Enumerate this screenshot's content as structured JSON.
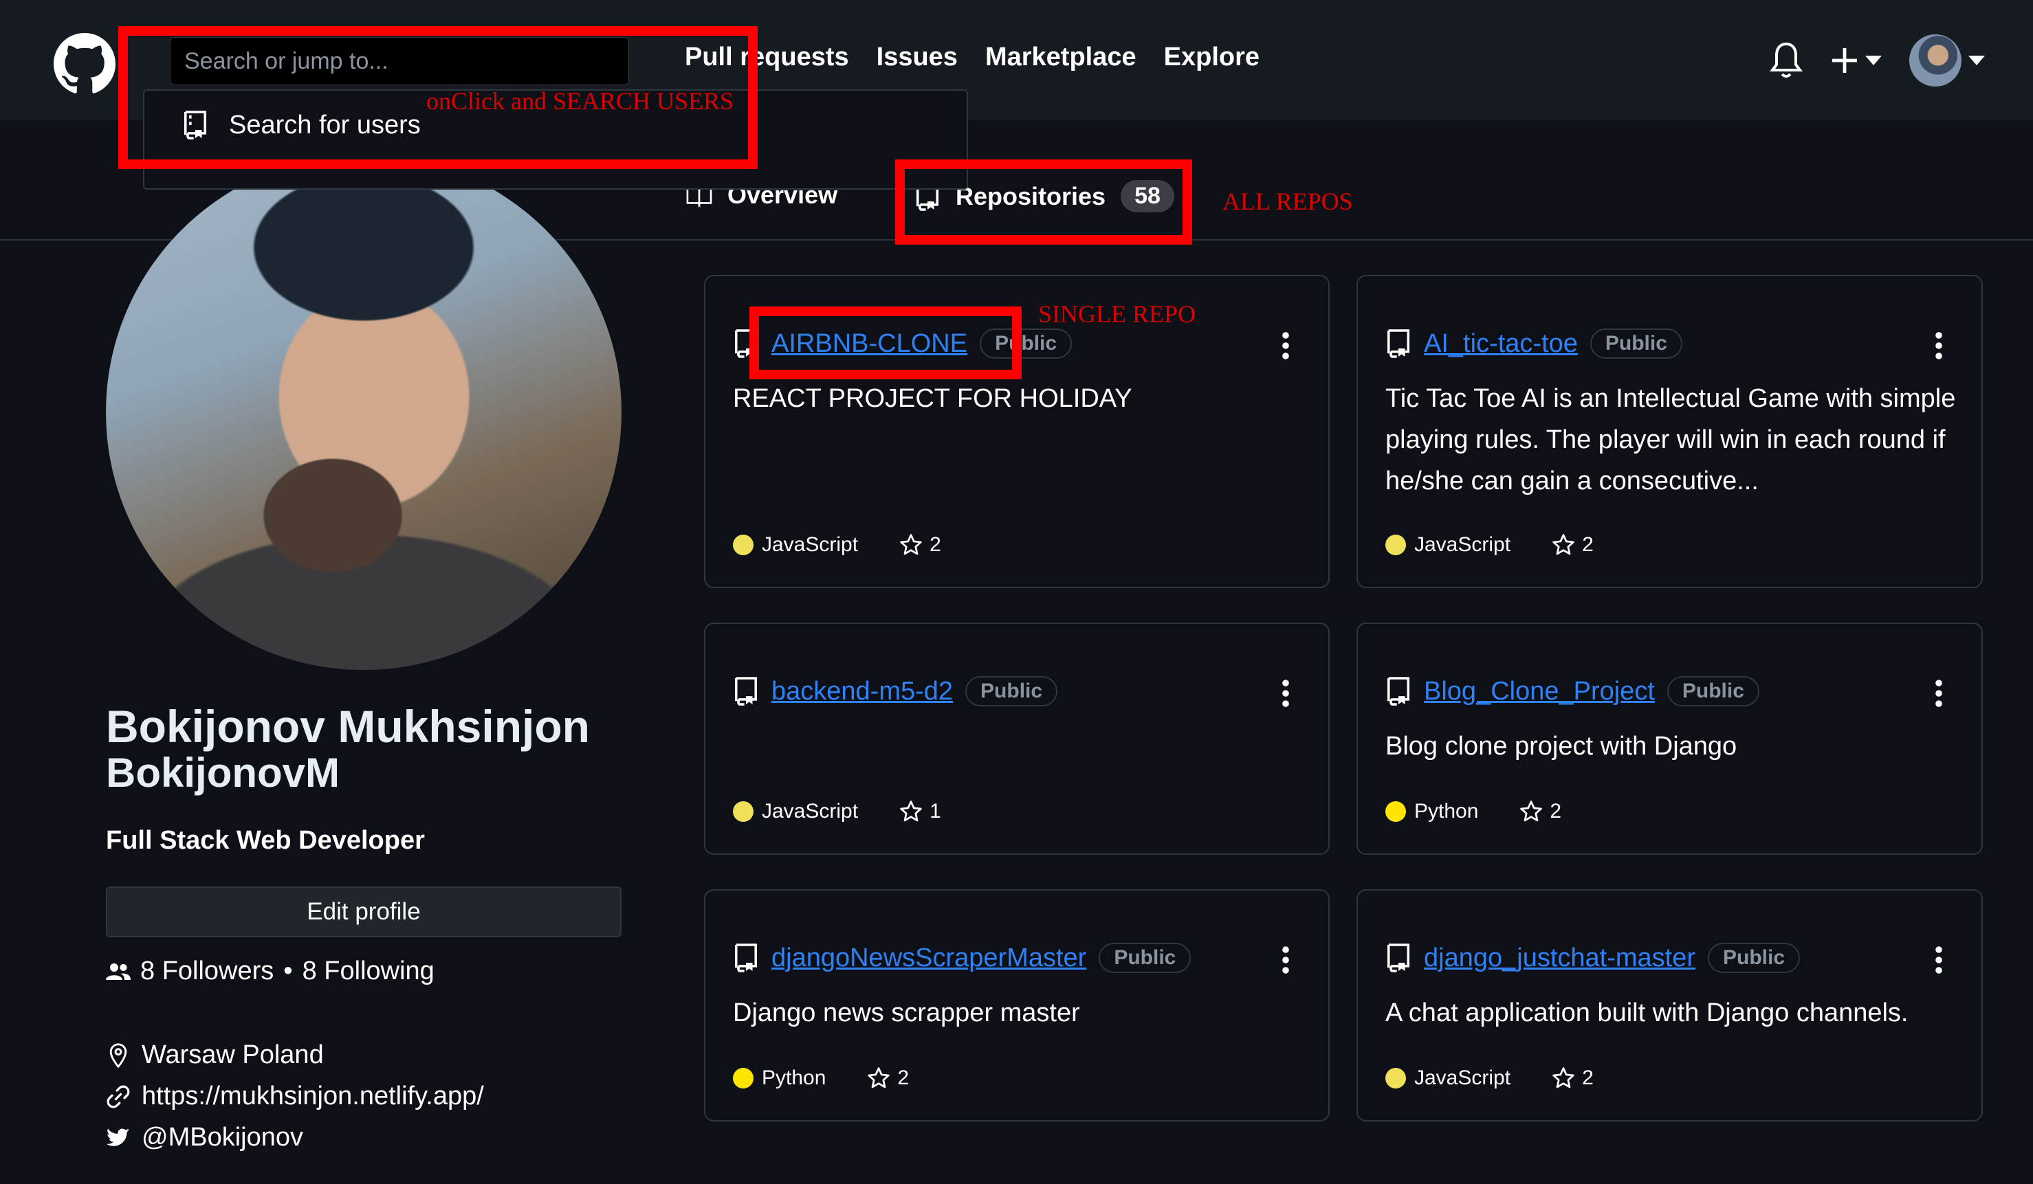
{
  "header": {
    "search_placeholder": "Search or jump to...",
    "nav": [
      "Pull requests",
      "Issues",
      "Marketplace",
      "Explore"
    ]
  },
  "dropdown": {
    "item_label": "Search for users"
  },
  "tabs": {
    "overview": "Overview",
    "repositories": "Repositories",
    "repo_count": "58"
  },
  "annotations": {
    "search": "onClick and SEARCH USERS",
    "all_repos": "ALL REPOS",
    "single_repo": "SINGLE REPO"
  },
  "profile": {
    "name": "Bokijonov Mukhsinjon",
    "username": "BokijonovM",
    "bio": "Full Stack Web Developer",
    "edit_button": "Edit profile",
    "followers": "8 Followers",
    "separator": "•",
    "following": "8 Following",
    "location": "Warsaw Poland",
    "website": "https://mukhsinjon.netlify.app/",
    "twitter": "@MBokijonov"
  },
  "repos": [
    {
      "name": "AIRBNB-CLONE",
      "visibility": "Public",
      "description": "REACT PROJECT FOR HOLIDAY",
      "language": "JavaScript",
      "stars": "2"
    },
    {
      "name": "AI_tic-tac-toe",
      "visibility": "Public",
      "description": "Tic Tac Toe AI is an Intellectual Game with simple playing rules. The player will win in each round if he/she can gain a consecutive...",
      "language": "JavaScript",
      "stars": "2"
    },
    {
      "name": "backend-m5-d2",
      "visibility": "Public",
      "description": "",
      "language": "JavaScript",
      "stars": "1"
    },
    {
      "name": "Blog_Clone_Project",
      "visibility": "Public",
      "description": "Blog clone project with Django",
      "language": "Python",
      "stars": "2"
    },
    {
      "name": "djangoNewsScraperMaster",
      "visibility": "Public",
      "description": "Django news scrapper master",
      "language": "Python",
      "stars": "2"
    },
    {
      "name": "django_justchat-master",
      "visibility": "Public",
      "description": "A chat application built with Django channels.",
      "language": "JavaScript",
      "stars": "2"
    }
  ],
  "colors": {
    "background": "#0d1117",
    "header": "#161b22",
    "link": "#2f81f7",
    "annotation_red": "#ff0000",
    "javascript": "#f1e05a",
    "python": "#ffe500"
  },
  "icons": [
    "github-logo-icon",
    "repo-icon",
    "book-icon",
    "bell-icon",
    "plus-icon",
    "caret-down-icon",
    "kebab-icon",
    "star-icon",
    "people-icon",
    "location-icon",
    "link-icon",
    "twitter-icon"
  ]
}
